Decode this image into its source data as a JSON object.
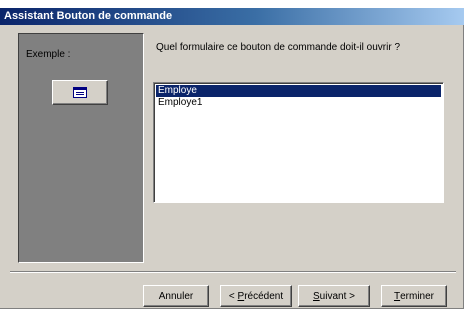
{
  "window": {
    "title": "Assistant Bouton de commande"
  },
  "example": {
    "label": "Exemple :",
    "button_icon": "form-icon"
  },
  "main": {
    "question": "Quel formulaire ce bouton de commande doit-il ouvrir ?",
    "forms": [
      {
        "label": "Employe",
        "selected": true
      },
      {
        "label": "Employe1",
        "selected": false
      }
    ]
  },
  "buttons": {
    "cancel": "Annuler",
    "previous_prefix": "< ",
    "previous_accel": "P",
    "previous_rest": "récédent",
    "next_accel": "S",
    "next_rest": "uivant >",
    "finish_accel": "T",
    "finish_rest": "erminer"
  },
  "colors": {
    "dialog_bg": "#d4d0c8",
    "title_gradient_start": "#0a246a",
    "title_gradient_end": "#a6caf0",
    "selection": "#0a246a",
    "example_panel": "#808080"
  }
}
